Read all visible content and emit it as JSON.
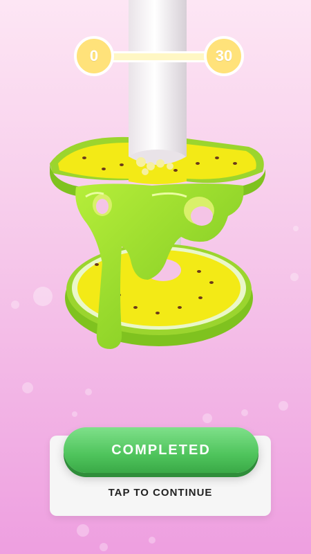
{
  "progress": {
    "start_level": "0",
    "end_level": "30",
    "fraction": 0.0
  },
  "result_panel": {
    "button_label": "COMPLETED",
    "hint_text": "TAP TO CONTINUE"
  },
  "colors": {
    "background_top": "#fde6f4",
    "background_bottom": "#ee9fe0",
    "button_green": "#4fc45c",
    "slime_green": "#9fde2e",
    "fruit_yellow": "#f4ec1c",
    "rind_green": "#8fcf2a",
    "pole_white": "#f2f2f2"
  }
}
